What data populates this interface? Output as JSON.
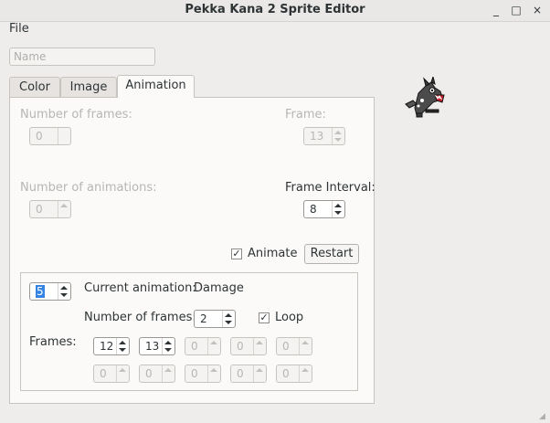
{
  "window": {
    "title": "Pekka Kana 2 Sprite Editor",
    "controls": [
      "_",
      "□",
      "×"
    ]
  },
  "menu": {
    "file_label": "File"
  },
  "name_field": {
    "placeholder": "Name",
    "value": ""
  },
  "tabs": [
    {
      "label": "Color"
    },
    {
      "label": "Image"
    },
    {
      "label": "Animation"
    }
  ],
  "active_tab": "Animation",
  "animation": {
    "num_frames_label": "Number of frames:",
    "num_frames_value": "0",
    "frame_label": "Frame:",
    "frame_value": "13",
    "num_animations_label": "Number of animations:",
    "num_animations_value": "0",
    "frame_interval_label": "Frame Interval:",
    "frame_interval_value": "8",
    "animate_label": "Animate",
    "animate_checked": true,
    "restart_label": "Restart",
    "anim_index_value": "5",
    "current_animation_label": "Current animation:",
    "current_animation_value": "Damage",
    "anim_num_frames_label": "Number of frames:",
    "anim_num_frames_value": "2",
    "loop_label": "Loop",
    "loop_checked": true,
    "frames_label": "Frames:",
    "frames_row1": [
      "12",
      "13",
      "0",
      "0",
      "0"
    ],
    "frames_row2": [
      "0",
      "0",
      "0",
      "0",
      "0"
    ]
  },
  "preview": {
    "icon": "sprite-creature-icon"
  }
}
